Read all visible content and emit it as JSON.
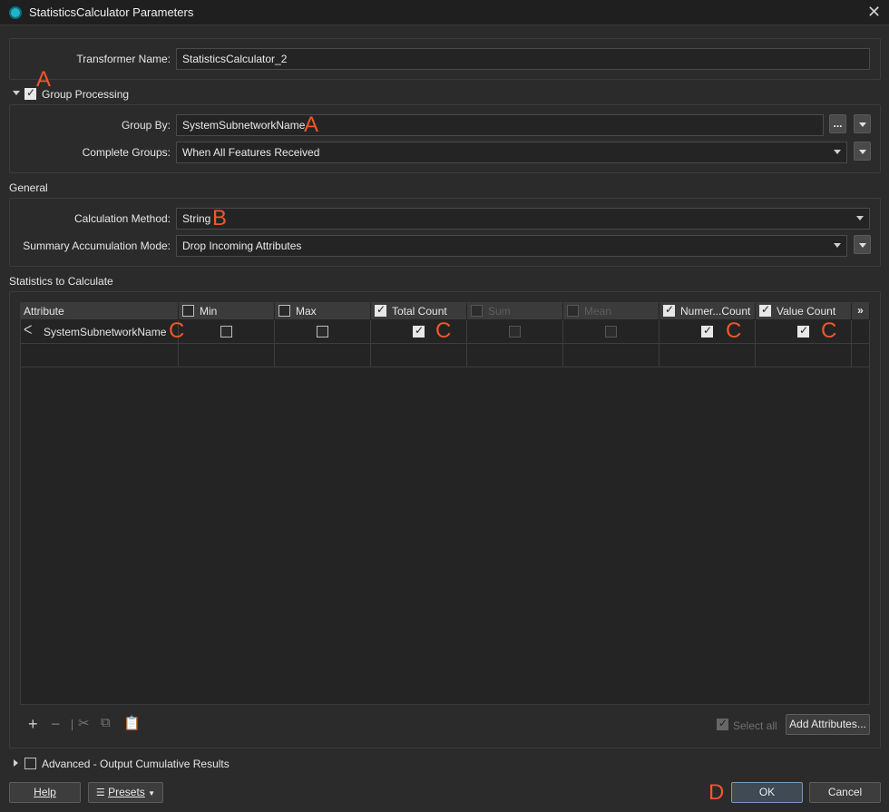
{
  "window": {
    "title": "StatisticsCalculator Parameters",
    "close_icon": "close-icon"
  },
  "transformer": {
    "label": "Transformer Name:",
    "value": "StatisticsCalculator_2"
  },
  "group_processing": {
    "label": "Group Processing",
    "checked": true,
    "group_by_label": "Group By:",
    "group_by_value": "SystemSubnetworkName",
    "group_by_more": "...",
    "complete_groups_label": "Complete Groups:",
    "complete_groups_value": "When All Features Received"
  },
  "general": {
    "title": "General",
    "calc_method_label": "Calculation Method:",
    "calc_method_value": "String",
    "summary_mode_label": "Summary Accumulation Mode:",
    "summary_mode_value": "Drop Incoming Attributes"
  },
  "statistics": {
    "title": "Statistics to Calculate",
    "columns": [
      {
        "label": "Attribute",
        "checked": null,
        "enabled": true
      },
      {
        "label": "Min",
        "checked": false,
        "enabled": true
      },
      {
        "label": "Max",
        "checked": false,
        "enabled": true
      },
      {
        "label": "Total Count",
        "checked": true,
        "enabled": true
      },
      {
        "label": "Sum",
        "checked": false,
        "enabled": false
      },
      {
        "label": "Mean",
        "checked": false,
        "enabled": false
      },
      {
        "label": "Numer...Count",
        "checked": true,
        "enabled": true
      },
      {
        "label": "Value Count",
        "checked": true,
        "enabled": true
      }
    ],
    "more_columns": "»",
    "rows": [
      {
        "attribute": "SystemSubnetworkName",
        "min": false,
        "max": false,
        "total_count": true,
        "sum": false,
        "mean": false,
        "numeric_count": true,
        "value_count": true
      }
    ],
    "select_all_label": "Select all",
    "add_attributes_label": "Add Attributes..."
  },
  "advanced": {
    "label": "Advanced - Output Cumulative Results",
    "checked": false
  },
  "footer": {
    "help": "Help",
    "presets": "Presets",
    "ok": "OK",
    "cancel": "Cancel"
  },
  "annotations": {
    "a": "A",
    "b": "B",
    "c": "C",
    "d": "D"
  },
  "colors": {
    "annotation": "#f0572b",
    "accent_teal": "#1fb6c8"
  }
}
